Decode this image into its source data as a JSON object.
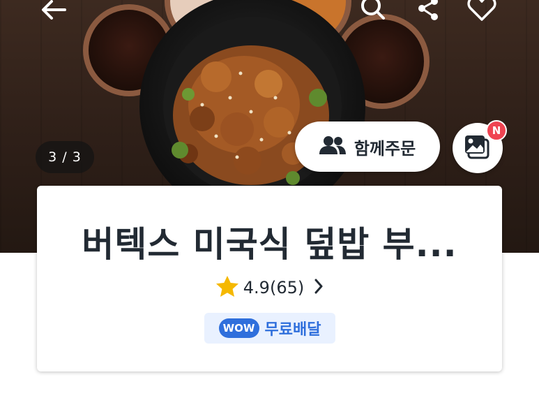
{
  "header": {
    "back_icon": "arrow-left-icon",
    "search_icon": "search-icon",
    "share_icon": "share-icon",
    "favorite_icon": "heart-icon"
  },
  "hero": {
    "image_counter": "3 / 3",
    "group_order_label": "함께주문",
    "group_order_icon": "people-icon",
    "photo_review_icon": "photo-gallery-icon",
    "new_badge": "N"
  },
  "store": {
    "name": "버텍스 미국식 덮밥 부...",
    "rating": "4.9(65)",
    "rating_icon": "star-icon",
    "wow_badge": "WOW",
    "delivery_label": "무료배달"
  },
  "colors": {
    "accent_blue": "#2f6fdc",
    "badge_red": "#ef4452",
    "star_yellow": "#f5b800",
    "text_dark": "#222a33"
  }
}
